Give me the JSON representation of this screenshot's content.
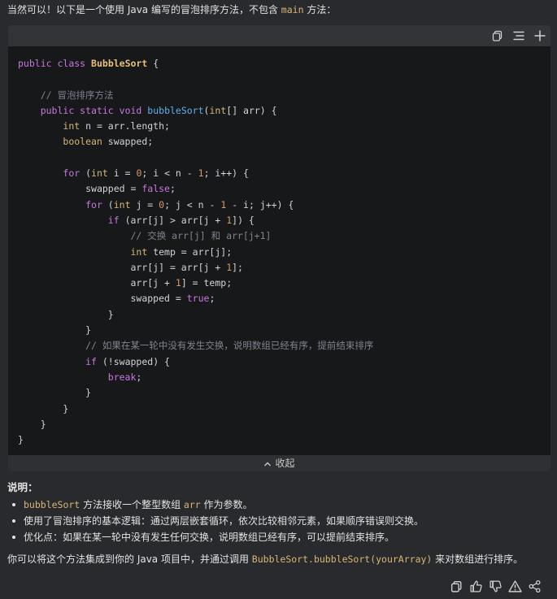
{
  "intro": {
    "before": "当然可以！以下是一个使用 Java 编写的冒泡排序方法，不包含 ",
    "code": "main",
    "after": " 方法："
  },
  "toolbar": {
    "icons": [
      "copy-icon",
      "outline-icon",
      "plus-icon"
    ]
  },
  "code": {
    "l1_kw1": "public",
    "l1_kw2": "class",
    "l1_cls": "BubbleSort",
    "l1_rest": " {",
    "l3": "// 冒泡排序方法",
    "l4_kw": "public static",
    "l4_ty": "void",
    "l4_fn": "bubbleSort",
    "l4_p1": "(",
    "l4_ty2": "int",
    "l4_p2": "[] arr) {",
    "l5_ty": "int",
    "l5_rest": " n = arr.length;",
    "l6_ty": "boolean",
    "l6_rest": " swapped;",
    "l8_kw": "for",
    "l8_a": " (",
    "l8_ty": "int",
    "l8_b": " i = ",
    "l8_n0": "0",
    "l8_c": "; i < n - ",
    "l8_n1": "1",
    "l8_d": "; i++) {",
    "l9_a": "swapped = ",
    "l9_kw": "false",
    "l9_b": ";",
    "l10_kw": "for",
    "l10_a": " (",
    "l10_ty": "int",
    "l10_b": " j = ",
    "l10_n0": "0",
    "l10_c": "; j < n - ",
    "l10_n1": "1",
    "l10_d": " - i; j++) {",
    "l11_kw": "if",
    "l11_a": " (arr[j] > arr[j + ",
    "l11_n": "1",
    "l11_b": "]) {",
    "l12": "// 交换 arr[j] 和 arr[j+1]",
    "l13_ty": "int",
    "l13_rest": " temp = arr[j];",
    "l14_a": "arr[j] = arr[j + ",
    "l14_n": "1",
    "l14_b": "];",
    "l15_a": "arr[j + ",
    "l15_n": "1",
    "l15_b": "] = temp;",
    "l16_a": "swapped = ",
    "l16_kw": "true",
    "l16_b": ";",
    "brace": "}",
    "l19": "// 如果在某一轮中没有发生交换，说明数组已经有序，提前结束排序",
    "l20_kw": "if",
    "l20_rest": " (!swapped) {",
    "l21_kw": "break",
    "l21_rest": ";"
  },
  "collapse_label": "收起",
  "explain": {
    "title": "说明：",
    "b1_code": "bubbleSort",
    "b1_mid": " 方法接收一个整型数组 ",
    "b1_code2": "arr",
    "b1_end": " 作为参数。",
    "b2": "使用了冒泡排序的基本逻辑：通过两层嵌套循环，依次比较相邻元素，如果顺序错误则交换。",
    "b3": "优化点：如果在某一轮中没有发生任何交换，说明数组已经有序，可以提前结束排序。"
  },
  "outro": {
    "before": "你可以将这个方法集成到你的 Java 项目中，并通过调用 ",
    "code": "BubbleSort.bubbleSort(yourArray)",
    "after": " 来对数组进行排序。"
  },
  "actions": [
    "copy-icon",
    "thumbs-up-icon",
    "thumbs-down-icon",
    "warning-icon",
    "share-icon"
  ]
}
